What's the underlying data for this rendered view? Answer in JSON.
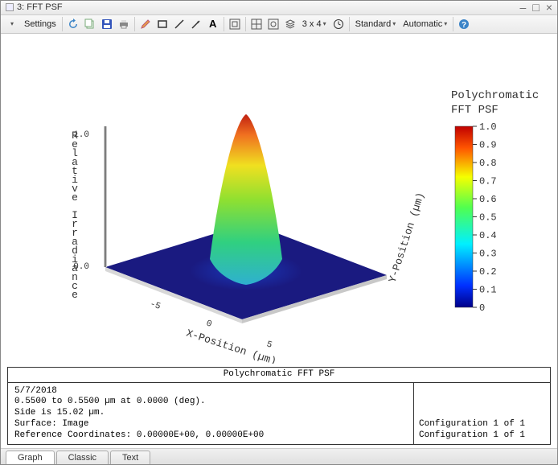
{
  "window": {
    "title": "3: FFT PSF"
  },
  "toolbar": {
    "settings_label": "Settings",
    "grid_label": "3 x 4",
    "mode1": "Standard",
    "mode2": "Automatic"
  },
  "plot": {
    "colorbar_title1": "Polychromatic",
    "colorbar_title2": "FFT PSF",
    "x_axis": "X-Position (µm)",
    "y_axis": "Y-Position (µm)",
    "z_axis": "Relative Irradiance",
    "z_tick_lo": "0.0",
    "z_tick_hi": "1.0",
    "colorbar_ticks": [
      "1.0",
      "0.9",
      "0.8",
      "0.7",
      "0.6",
      "0.5",
      "0.4",
      "0.3",
      "0.2",
      "0.1",
      "0"
    ],
    "x_ticks": [
      "-5",
      "0",
      "5"
    ]
  },
  "info": {
    "title": "Polychromatic FFT PSF",
    "date": "5/7/2018",
    "line2": "0.5500 to 0.5500 µm at 0.0000 (deg).",
    "line3": "Side is 15.02 µm.",
    "line4": "Surface: Image",
    "line5": "Reference Coordinates: 0.00000E+00, 0.00000E+00",
    "config1": "Configuration 1 of 1",
    "config2": "Configuration 1 of 1"
  },
  "tabs": {
    "graph": "Graph",
    "classic": "Classic",
    "text": "Text"
  },
  "chart_data": {
    "type": "heatmap",
    "title": "Polychromatic FFT PSF",
    "xlabel": "X-Position (µm)",
    "ylabel": "Y-Position (µm)",
    "zlabel": "Relative Irradiance",
    "xlim": [
      -7.51,
      7.51
    ],
    "ylim": [
      -7.51,
      7.51
    ],
    "zlim": [
      0,
      1.0
    ],
    "colorbar_range": [
      0,
      1.0
    ],
    "x_ticks_shown": [
      -5,
      0,
      5
    ],
    "description": "3D surface plot of point spread function; central Gaussian-like peak at (0,0) reaching 1.0 relative irradiance, falling to ~0 near edges over ~15 µm square domain.",
    "peak": {
      "x": 0,
      "y": 0,
      "value": 1.0
    }
  }
}
